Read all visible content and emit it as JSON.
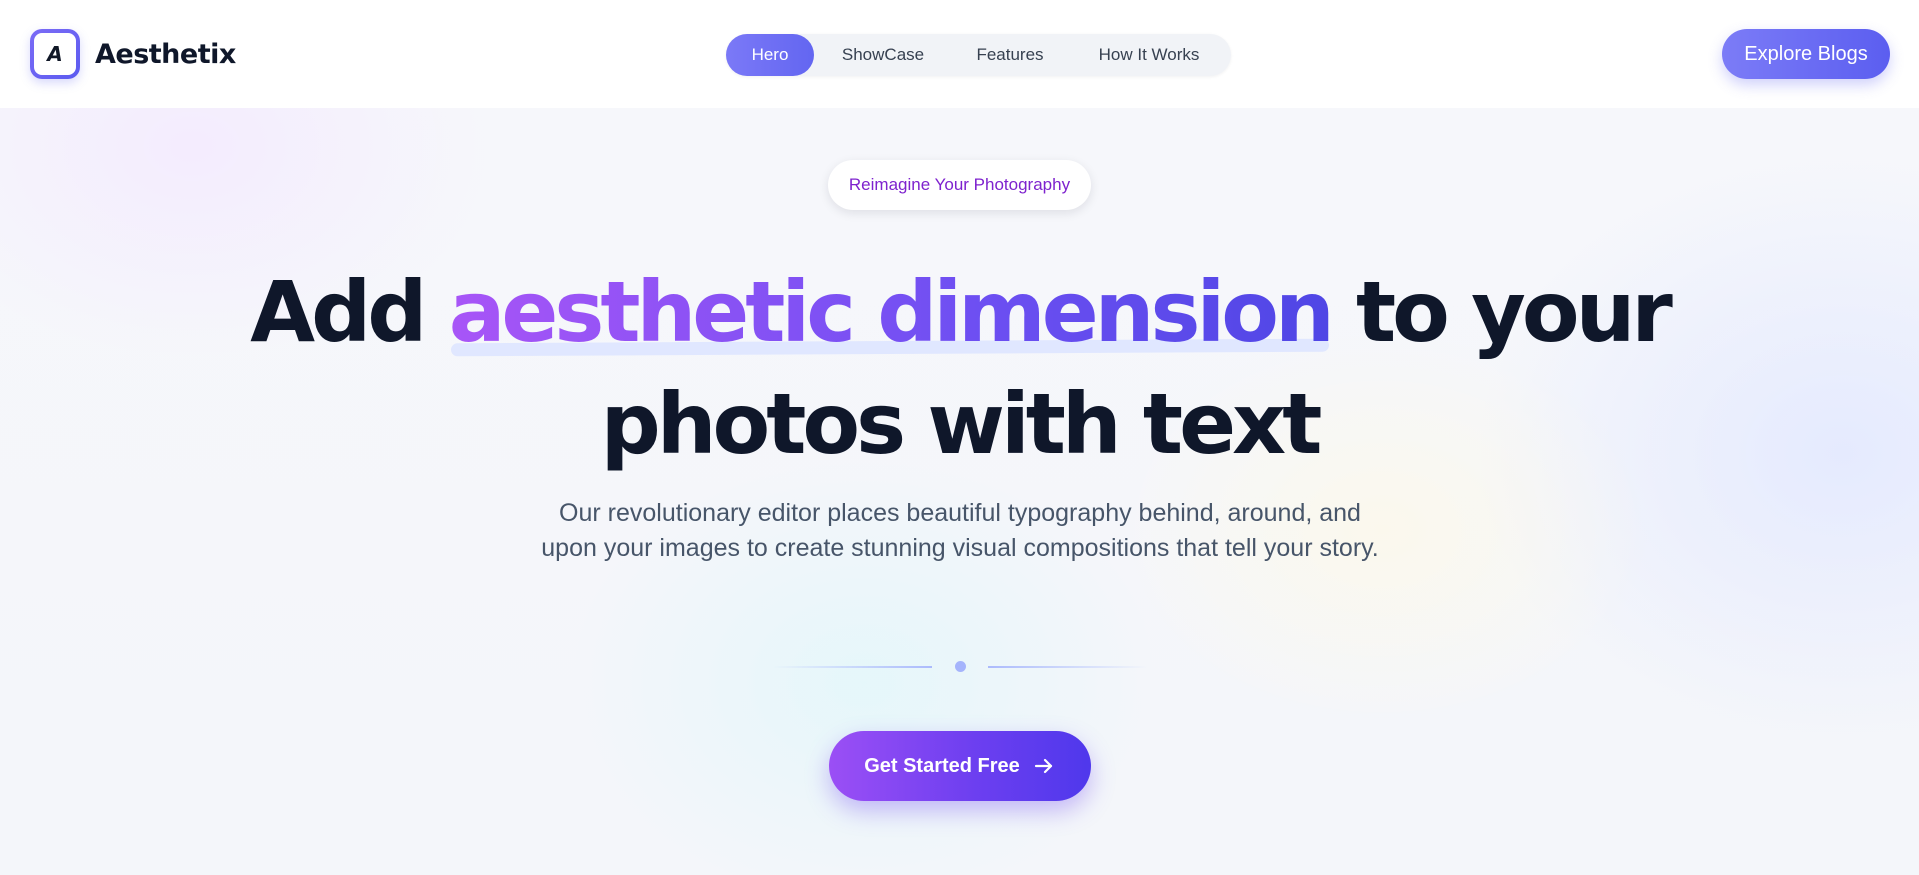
{
  "brand": {
    "logo_letter": "A",
    "name": "Aesthetix"
  },
  "nav": {
    "items": [
      {
        "label": "Hero",
        "active": true
      },
      {
        "label": "ShowCase",
        "active": false
      },
      {
        "label": "Features",
        "active": false
      },
      {
        "label": "How It Works",
        "active": false
      }
    ]
  },
  "header": {
    "cta_label": "Explore Blogs"
  },
  "hero": {
    "tag": "Reimagine Your Photography",
    "headline": {
      "prefix": "Add",
      "accent": "aesthetic dimension",
      "suffix": "to your",
      "line2": "photos with text"
    },
    "subtitle": "Our revolutionary editor places beautiful typography behind, around, and upon your images to create stunning visual compositions that tell your story.",
    "cta_label": "Get Started Free",
    "cta_icon": "arrow-right-icon"
  },
  "colors": {
    "accent_start": "#a855f7",
    "accent_end": "#4f46e5",
    "nav_active": "#6366f1",
    "heading": "#0f172a",
    "tag_text": "#7e22ce"
  }
}
